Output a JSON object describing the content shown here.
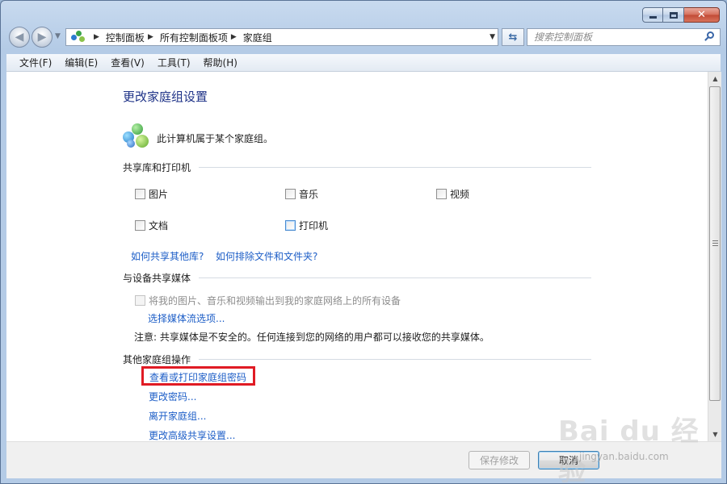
{
  "window": {
    "caption": {
      "minimize": "",
      "maximize": "",
      "close": "✕"
    }
  },
  "address": {
    "crumbs": [
      "控制面板",
      "所有控制面板项",
      "家庭组"
    ]
  },
  "search": {
    "placeholder": "搜索控制面板"
  },
  "menu": {
    "items": [
      "文件(F)",
      "编辑(E)",
      "查看(V)",
      "工具(T)",
      "帮助(H)"
    ]
  },
  "main": {
    "title": "更改家庭组设置",
    "membership_text": "此计算机属于某个家庭组。",
    "share_section": {
      "title": "共享库和打印机",
      "items": [
        {
          "label": "图片",
          "checked": false
        },
        {
          "label": "音乐",
          "checked": false
        },
        {
          "label": "视频",
          "checked": false
        },
        {
          "label": "文档",
          "checked": false
        },
        {
          "label": "打印机",
          "checked": false
        }
      ],
      "links": [
        "如何共享其他库?",
        "如何排除文件和文件夹?"
      ]
    },
    "media_section": {
      "title": "与设备共享媒体",
      "checkbox_label": "将我的图片、音乐和视频输出到我的家庭网络上的所有设备",
      "link": "选择媒体流选项...",
      "note": "注意: 共享媒体是不安全的。任何连接到您的网络的用户都可以接收您的共享媒体。"
    },
    "other_section": {
      "title": "其他家庭组操作",
      "links": [
        "查看或打印家庭组密码",
        "更改密码...",
        "离开家庭组...",
        "更改高级共享设置..."
      ]
    }
  },
  "footer": {
    "save_label": "保存修改",
    "cancel_label": "取消"
  },
  "watermark": {
    "logo": "Bai du 经验",
    "url": "jingyan.baidu.com"
  },
  "colors": {
    "link": "#1d5ec7",
    "title": "#1e3287",
    "highlight": "#e01b24"
  }
}
